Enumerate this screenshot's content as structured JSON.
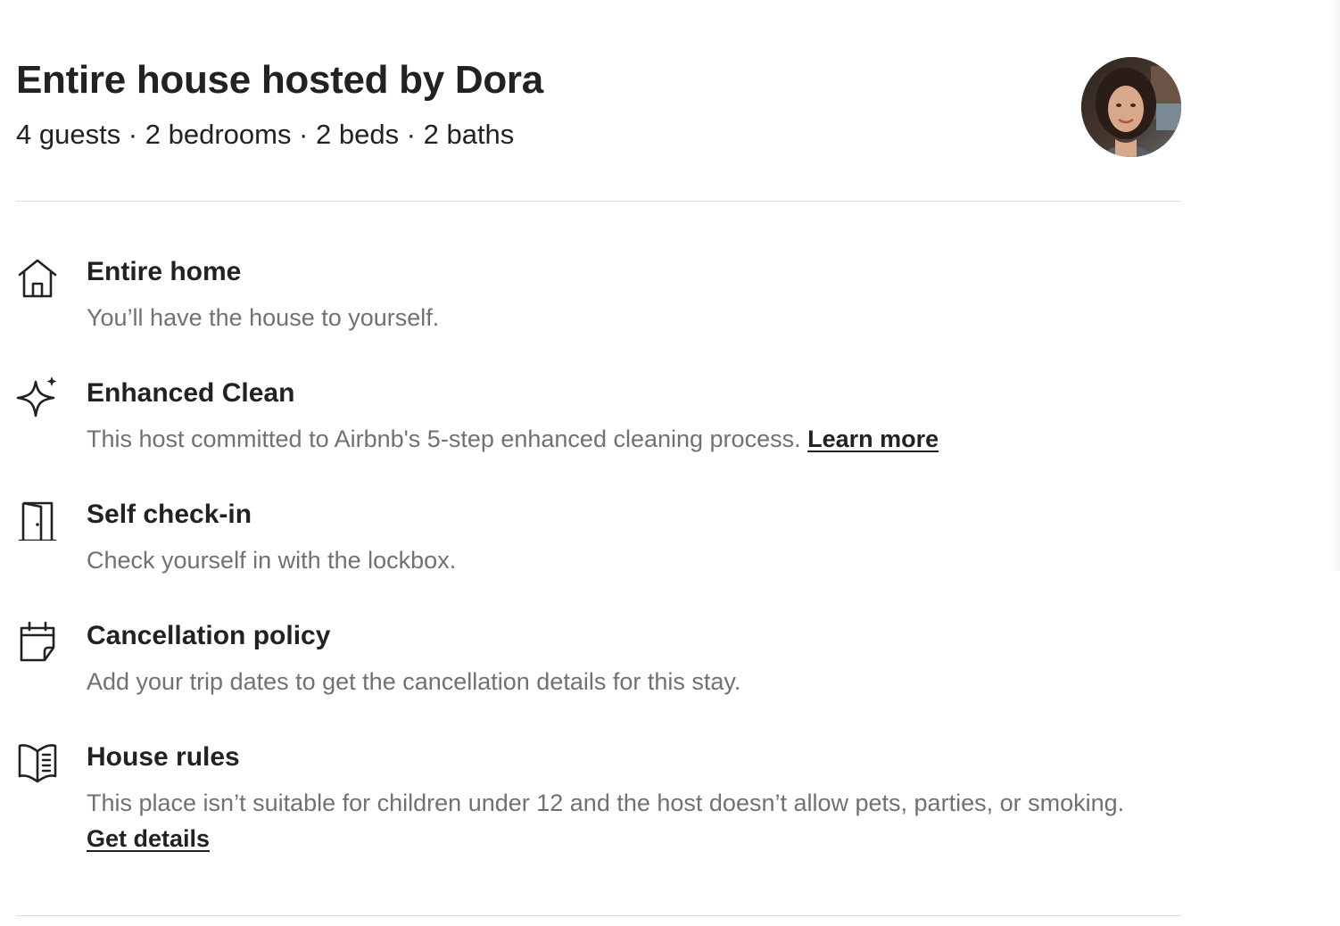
{
  "listing": {
    "title": "Entire house hosted by Dora",
    "summary": "4 guests · 2 bedrooms · 2 beds · 2 baths",
    "avatar_alt": "Dora"
  },
  "features": [
    {
      "icon": "house-icon",
      "title": "Entire home",
      "description": "You’ll have the house to yourself."
    },
    {
      "icon": "sparkle-icon",
      "title": "Enhanced Clean",
      "description": "This host committed to Airbnb's 5-step enhanced cleaning process.",
      "link": "Learn more"
    },
    {
      "icon": "door-icon",
      "title": "Self check-in",
      "description": "Check yourself in with the lockbox."
    },
    {
      "icon": "calendar-icon",
      "title": "Cancellation policy",
      "description": "Add your trip dates to get the cancellation details for this stay."
    },
    {
      "icon": "rulebook-icon",
      "title": "House rules",
      "description": "This place isn’t suitable for children under 12 and the host doesn’t allow pets, parties, or smoking.",
      "link": "Get details"
    }
  ],
  "colors": {
    "text_primary": "#222222",
    "text_secondary": "#717171",
    "divider": "#dddddd",
    "background": "#ffffff"
  }
}
